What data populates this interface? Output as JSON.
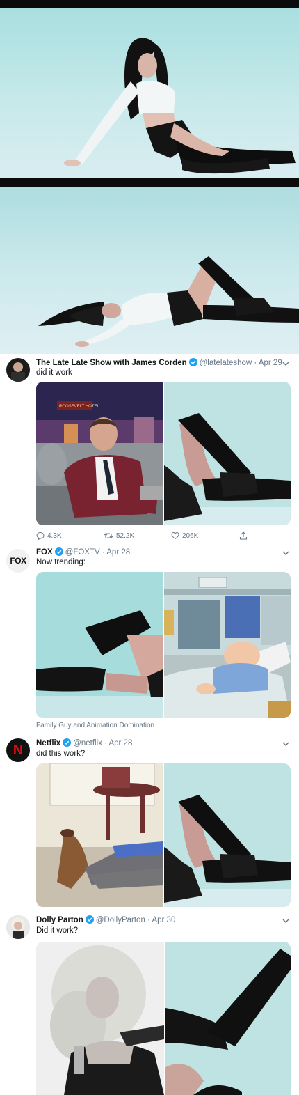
{
  "tweets": [
    {
      "name": "The Late Late Show with James Corden",
      "handle": "@latelateshow",
      "date": "· Apr 29",
      "text": "did it work",
      "replies": "4.3K",
      "retweets": "52.2K",
      "likes": "206K"
    },
    {
      "name": "FOX",
      "handle": "@FOXTV",
      "date": "· Apr 28",
      "text": "Now trending:",
      "caption": "Family Guy and Animation Domination",
      "avatar_text": "FOX"
    },
    {
      "name": "Netflix",
      "handle": "@netflix",
      "date": "· Apr 28",
      "text": "did this work?",
      "avatar_text": "N"
    },
    {
      "name": "Dolly Parton",
      "handle": "@DollyParton",
      "date": "· Apr 30",
      "text": "Did it work?"
    }
  ],
  "sign_text": "ROOSEVELT HOTEL",
  "colors": {
    "verified": "#1da1f2",
    "netflix": "#e50914",
    "muted": "#657786",
    "teal_bg": "#bfe5e6"
  }
}
